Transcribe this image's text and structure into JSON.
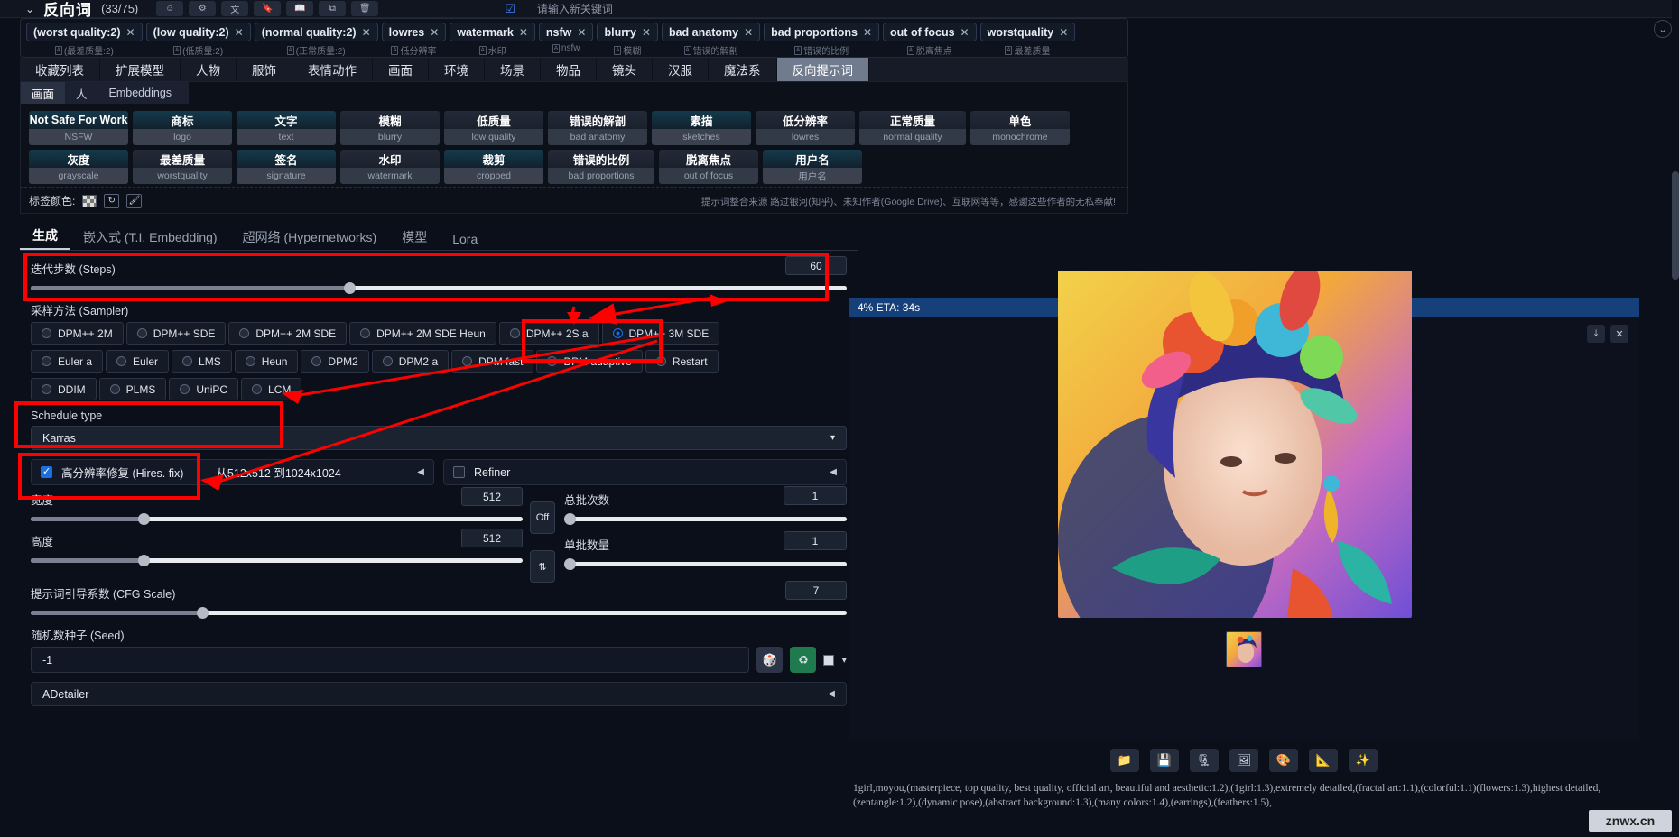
{
  "topbar": {
    "title": "反向词",
    "count": "(33/75)",
    "placeholder": "请输入新关键词",
    "icons": [
      "emoji-icon",
      "gear-icon",
      "translate-icon",
      "bookmark-icon",
      "book-icon",
      "copy-icon",
      "trash-icon"
    ]
  },
  "chips": [
    {
      "text": "(worst quality:2)",
      "sub": "(最差质量:2)",
      "paren": true
    },
    {
      "text": "(low quality:2)",
      "sub": "(低质量:2)",
      "paren": true
    },
    {
      "text": "(normal quality:2)",
      "sub": "(正常质量:2)",
      "paren": true
    },
    {
      "text": "lowres",
      "sub": "低分辨率",
      "paren": false
    },
    {
      "text": "watermark",
      "sub": "水印",
      "paren": false
    },
    {
      "text": "nsfw",
      "sub": "nsfw",
      "paren": false
    },
    {
      "text": "blurry",
      "sub": "模糊",
      "paren": false
    },
    {
      "text": "bad anatomy",
      "sub": "错误的解剖",
      "paren": false
    },
    {
      "text": "bad proportions",
      "sub": "错误的比例",
      "paren": false
    },
    {
      "text": "out of focus",
      "sub": "脱离焦点",
      "paren": false
    },
    {
      "text": "worstquality",
      "sub": "最差质量",
      "paren": false
    }
  ],
  "category_tabs": [
    {
      "label": "收藏列表",
      "active": false
    },
    {
      "label": "扩展模型",
      "active": false
    },
    {
      "label": "人物",
      "active": false
    },
    {
      "label": "服饰",
      "active": false
    },
    {
      "label": "表情动作",
      "active": false
    },
    {
      "label": "画面",
      "active": false
    },
    {
      "label": "环境",
      "active": false
    },
    {
      "label": "场景",
      "active": false
    },
    {
      "label": "物品",
      "active": false
    },
    {
      "label": "镜头",
      "active": false
    },
    {
      "label": "汉服",
      "active": false
    },
    {
      "label": "魔法系",
      "active": false
    },
    {
      "label": "反向提示词",
      "active": true
    }
  ],
  "embedding_tabs": [
    {
      "label": "画面",
      "active": true
    },
    {
      "label": "人",
      "active": false
    },
    {
      "label": "Embeddings",
      "active": false
    }
  ],
  "tag_cards": [
    {
      "cn": "Not Safe For Work",
      "en": "NSFW",
      "highlight": true
    },
    {
      "cn": "商标",
      "en": "logo",
      "highlight": true
    },
    {
      "cn": "文字",
      "en": "text",
      "highlight": true
    },
    {
      "cn": "模糊",
      "en": "blurry",
      "highlight": false
    },
    {
      "cn": "低质量",
      "en": "low quality",
      "highlight": false
    },
    {
      "cn": "错误的解剖",
      "en": "bad anatomy",
      "highlight": false
    },
    {
      "cn": "素描",
      "en": "sketches",
      "highlight": true
    },
    {
      "cn": "低分辨率",
      "en": "lowres",
      "highlight": false
    },
    {
      "cn": "正常质量",
      "en": "normal quality",
      "highlight": false
    },
    {
      "cn": "单色",
      "en": "monochrome",
      "highlight": false
    },
    {
      "cn": "灰度",
      "en": "grayscale",
      "highlight": true
    },
    {
      "cn": "最差质量",
      "en": "worstquality",
      "highlight": false
    },
    {
      "cn": "签名",
      "en": "signature",
      "highlight": true
    },
    {
      "cn": "水印",
      "en": "watermark",
      "highlight": false
    },
    {
      "cn": "裁剪",
      "en": "cropped",
      "highlight": true
    },
    {
      "cn": "错误的比例",
      "en": "bad proportions",
      "highlight": false
    },
    {
      "cn": "脱离焦点",
      "en": "out of focus",
      "highlight": false
    },
    {
      "cn": "用户名",
      "en": "用户名",
      "highlight": true
    }
  ],
  "color_row": {
    "label": "标签颜色:",
    "reset_icon": "reset-circle-icon",
    "clear_icon": "eraser-icon",
    "credit": "提示词整合来源 路过银河(知乎)、未知作者(Google Drive)、互联网等等，感谢这些作者的无私奉献!"
  },
  "gen_tabs": [
    {
      "label": "生成",
      "active": true
    },
    {
      "label": "嵌入式 (T.I. Embedding)",
      "active": false
    },
    {
      "label": "超网络 (Hypernetworks)",
      "active": false
    },
    {
      "label": "模型",
      "active": false
    },
    {
      "label": "Lora",
      "active": false
    }
  ],
  "settings": {
    "steps_label": "迭代步数 (Steps)",
    "steps_value": "60",
    "steps_pct": 39,
    "sampler_label": "采样方法 (Sampler)",
    "samplers_row1": [
      "DPM++ 2M",
      "DPM++ SDE",
      "DPM++ 2M SDE",
      "DPM++ 2M SDE Heun",
      "DPM++ 2S a",
      "DPM++ 3M SDE"
    ],
    "samplers_row2": [
      "Euler a",
      "Euler",
      "LMS",
      "Heun",
      "DPM2",
      "DPM2 a",
      "DPM fast",
      "DPM adaptive",
      "Restart"
    ],
    "samplers_row3": [
      "DDIM",
      "PLMS",
      "UniPC",
      "LCM"
    ],
    "sampler_selected": "DPM++ 3M SDE",
    "schedule_label": "Schedule type",
    "schedule_value": "Karras",
    "hires_label": "高分辨率修复 (Hires. fix)",
    "hires_checked": true,
    "hires_info": "从512x512 到1024x1024",
    "refiner_label": "Refiner",
    "refiner_checked": false,
    "width_label": "宽度",
    "width_value": "512",
    "width_pct": 23,
    "height_label": "高度",
    "height_value": "512",
    "height_pct": 23,
    "swap_icon": "swap-vertical-icon",
    "off_label": "Off",
    "batch_count_label": "总批次数",
    "batch_count_value": "1",
    "batch_size_label": "单批数量",
    "batch_size_value": "1",
    "cfg_label": "提示词引导系数 (CFG Scale)",
    "cfg_value": "7",
    "cfg_pct": 21,
    "seed_label": "随机数种子 (Seed)",
    "seed_value": "-1",
    "seed_dice_icon": "dice-icon",
    "seed_recycle_icon": "recycle-icon",
    "adetailer_label": "ADetailer"
  },
  "preview": {
    "eta": "4% ETA: 34s",
    "download_icon": "download-icon",
    "close_icon": "close-icon",
    "actions": [
      "folder-icon",
      "save-icon",
      "zip-icon",
      "img2img-icon",
      "palette-icon",
      "ruler-icon",
      "sparkle-icon"
    ]
  },
  "prompt_output": "1girl,moyou,(masterpiece, top quality, best quality, official art, beautiful and aesthetic:1.2),(1girl:1.3),extremely detailed,(fractal art:1.1),(colorful:1.1)(flowers:1.3),highest detailed,(zentangle:1.2),(dynamic pose),(abstract background:1.3),(many colors:1.4),(earrings),(feathers:1.5),",
  "watermark": "znwx.cn",
  "colors": {
    "accent_blue": "#1b6fe0",
    "annotation_red": "#ff0000",
    "eta_bar": "#16407a"
  }
}
